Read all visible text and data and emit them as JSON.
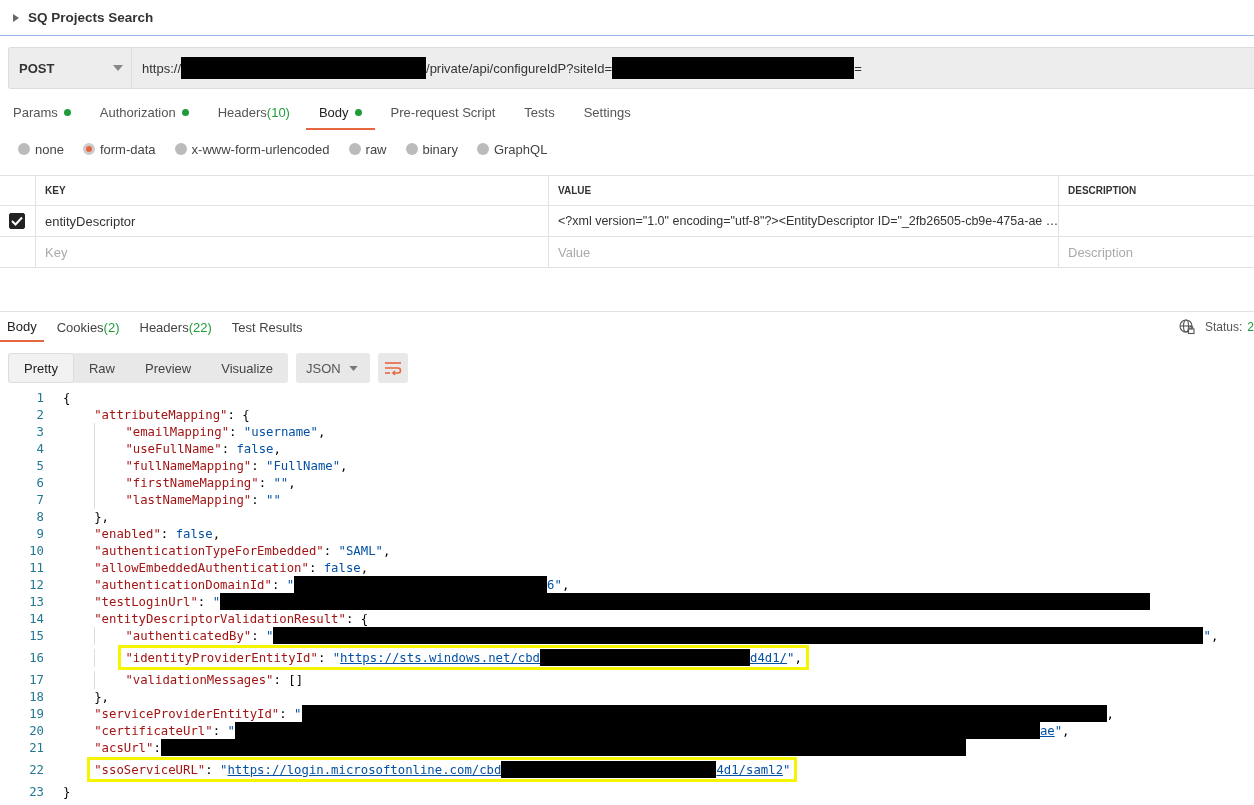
{
  "collection": {
    "title": "SQ Projects Search",
    "expanded": false
  },
  "request": {
    "method": "POST",
    "url": [
      {
        "kind": "text",
        "text": "https://"
      },
      {
        "kind": "redacted"
      },
      {
        "kind": "text",
        "text": "/private/api/configureIdP?siteId="
      },
      {
        "kind": "redacted"
      },
      {
        "kind": "text",
        "text": "="
      }
    ]
  },
  "request_tabs": [
    {
      "label": "Params",
      "dot": true,
      "selected": false
    },
    {
      "label": "Authorization",
      "dot": true,
      "selected": false
    },
    {
      "label": "Headers",
      "count": "(10)",
      "dot": false,
      "selected": false
    },
    {
      "label": "Body",
      "dot": true,
      "selected": true
    },
    {
      "label": "Pre-request Script",
      "dot": false,
      "selected": false
    },
    {
      "label": "Tests",
      "dot": false,
      "selected": false
    },
    {
      "label": "Settings",
      "dot": false,
      "selected": false
    }
  ],
  "body_types": [
    {
      "label": "none",
      "selected": false
    },
    {
      "label": "form-data",
      "selected": true
    },
    {
      "label": "x-www-form-urlencoded",
      "selected": false
    },
    {
      "label": "raw",
      "selected": false
    },
    {
      "label": "binary",
      "selected": false
    },
    {
      "label": "GraphQL",
      "selected": false
    }
  ],
  "form_table": {
    "columns": [
      "KEY",
      "VALUE",
      "DESCRIPTION"
    ],
    "rows": [
      {
        "checked": true,
        "key": "entityDescriptor",
        "value": "<?xml version=\"1.0\" encoding=\"utf-8\"?><EntityDescriptor ID=\"_2fb26505-cb9e-475a-ae …"
      }
    ],
    "empty_row": {
      "key": {
        "placeholder": "Key"
      },
      "value": {
        "placeholder": "Value"
      },
      "description": {
        "placeholder": "Description"
      }
    }
  },
  "response_tabs": [
    {
      "label": "Body",
      "selected": true
    },
    {
      "label": "Cookies",
      "count": "(2)",
      "selected": false
    },
    {
      "label": "Headers",
      "count": "(22)",
      "selected": false
    },
    {
      "label": "Test Results",
      "selected": false
    }
  ],
  "status": {
    "label": "Status:",
    "value": "2"
  },
  "view_modes": [
    {
      "label": "Pretty",
      "selected": true
    },
    {
      "label": "Raw",
      "selected": false
    },
    {
      "label": "Preview",
      "selected": false
    },
    {
      "label": "Visualize",
      "selected": false
    }
  ],
  "format": "JSON",
  "code": [
    {
      "number": "1",
      "segments": [
        {
          "kind": "punct",
          "text": "{"
        }
      ],
      "children": [
        {
          "number": "2",
          "segments": [
            {
              "kind": "key",
              "text": "\"attributeMapping\""
            },
            {
              "kind": "punct",
              "text": ": {"
            }
          ],
          "children": [
            {
              "number": "3",
              "segments": [
                {
                  "kind": "key",
                  "text": "\"emailMapping\""
                },
                {
                  "kind": "punct",
                  "text": ": "
                },
                {
                  "kind": "string",
                  "text": "\"username\""
                },
                {
                  "kind": "punct",
                  "text": ","
                }
              ]
            },
            {
              "number": "4",
              "segments": [
                {
                  "kind": "key",
                  "text": "\"useFullName\""
                },
                {
                  "kind": "punct",
                  "text": ": "
                },
                {
                  "kind": "string",
                  "text": "false"
                },
                {
                  "kind": "punct",
                  "text": ","
                }
              ]
            },
            {
              "number": "5",
              "segments": [
                {
                  "kind": "key",
                  "text": "\"fullNameMapping\""
                },
                {
                  "kind": "punct",
                  "text": ": "
                },
                {
                  "kind": "string",
                  "text": "\"FullName\""
                },
                {
                  "kind": "punct",
                  "text": ","
                }
              ]
            },
            {
              "number": "6",
              "segments": [
                {
                  "kind": "key",
                  "text": "\"firstNameMapping\""
                },
                {
                  "kind": "punct",
                  "text": ": "
                },
                {
                  "kind": "string",
                  "text": "\"\""
                },
                {
                  "kind": "punct",
                  "text": ","
                }
              ]
            },
            {
              "number": "7",
              "segments": [
                {
                  "kind": "key",
                  "text": "\"lastNameMapping\""
                },
                {
                  "kind": "punct",
                  "text": ": "
                },
                {
                  "kind": "string",
                  "text": "\"\""
                }
              ]
            }
          ]
        },
        {
          "number": "8",
          "segments": [
            {
              "kind": "punct",
              "text": "},"
            }
          ]
        },
        {
          "number": "9",
          "segments": [
            {
              "kind": "key",
              "text": "\"enabled\""
            },
            {
              "kind": "punct",
              "text": ": "
            },
            {
              "kind": "string",
              "text": "false"
            },
            {
              "kind": "punct",
              "text": ","
            }
          ]
        },
        {
          "number": "10",
          "segments": [
            {
              "kind": "key",
              "text": "\"authenticationTypeForEmbedded\""
            },
            {
              "kind": "punct",
              "text": ": "
            },
            {
              "kind": "string",
              "text": "\"SAML\""
            },
            {
              "kind": "punct",
              "text": ","
            }
          ]
        },
        {
          "number": "11",
          "segments": [
            {
              "kind": "key",
              "text": "\"allowEmbeddedAuthentication\""
            },
            {
              "kind": "punct",
              "text": ": "
            },
            {
              "kind": "string",
              "text": "false"
            },
            {
              "kind": "punct",
              "text": ","
            }
          ]
        },
        {
          "number": "12",
          "segments": [
            {
              "kind": "key",
              "text": "\"authenticationDomainId\""
            },
            {
              "kind": "punct",
              "text": ": "
            },
            {
              "kind": "string",
              "text": "\""
            },
            {
              "kind": "redacted"
            },
            {
              "kind": "string",
              "text": "6\""
            },
            {
              "kind": "punct",
              "text": ","
            }
          ]
        },
        {
          "number": "13",
          "segments": [
            {
              "kind": "key",
              "text": "\"testLoginUrl\""
            },
            {
              "kind": "punct",
              "text": ": "
            },
            {
              "kind": "string",
              "text": "\""
            },
            {
              "kind": "redacted"
            }
          ]
        },
        {
          "number": "14",
          "segments": [
            {
              "kind": "key",
              "text": "\"entityDescriptorValidationResult\""
            },
            {
              "kind": "punct",
              "text": ": {"
            }
          ],
          "children": [
            {
              "number": "15",
              "segments": [
                {
                  "kind": "key",
                  "text": "\"authenticatedBy\""
                },
                {
                  "kind": "punct",
                  "text": ": "
                },
                {
                  "kind": "string",
                  "text": "\""
                },
                {
                  "kind": "redacted"
                },
                {
                  "kind": "string",
                  "text": "\""
                },
                {
                  "kind": "punct",
                  "text": ","
                }
              ]
            },
            {
              "number": "16",
              "highlighted": true,
              "segments": [
                {
                  "kind": "key",
                  "text": "\"identityProviderEntityId\""
                },
                {
                  "kind": "punct",
                  "text": ": "
                },
                {
                  "kind": "string",
                  "text": "\""
                },
                {
                  "kind": "link",
                  "text": "https://sts.windows.net/cbd"
                },
                {
                  "kind": "redacted"
                },
                {
                  "kind": "link",
                  "text": "d4d1/"
                },
                {
                  "kind": "string",
                  "text": "\""
                },
                {
                  "kind": "punct",
                  "text": ","
                }
              ]
            },
            {
              "number": "17",
              "segments": [
                {
                  "kind": "key",
                  "text": "\"validationMessages\""
                },
                {
                  "kind": "punct",
                  "text": ": []"
                }
              ]
            }
          ]
        },
        {
          "number": "18",
          "segments": [
            {
              "kind": "punct",
              "text": "},"
            }
          ]
        },
        {
          "number": "19",
          "segments": [
            {
              "kind": "key",
              "text": "\"serviceProviderEntityId\""
            },
            {
              "kind": "punct",
              "text": ": "
            },
            {
              "kind": "string",
              "text": "\""
            },
            {
              "kind": "redacted"
            },
            {
              "kind": "punct",
              "text": ","
            }
          ]
        },
        {
          "number": "20",
          "segments": [
            {
              "kind": "key",
              "text": "\"certificateUrl\""
            },
            {
              "kind": "punct",
              "text": ": "
            },
            {
              "kind": "string",
              "text": "\""
            },
            {
              "kind": "redacted"
            },
            {
              "kind": "link",
              "text": "ae"
            },
            {
              "kind": "string",
              "text": "\""
            },
            {
              "kind": "punct",
              "text": ","
            }
          ]
        },
        {
          "number": "21",
          "segments": [
            {
              "kind": "key",
              "text": "\"acsUrl\""
            },
            {
              "kind": "punct",
              "text": ":"
            },
            {
              "kind": "redacted"
            }
          ]
        },
        {
          "number": "22",
          "highlighted": true,
          "segments": [
            {
              "kind": "key",
              "text": "\"ssoServiceURL\""
            },
            {
              "kind": "punct",
              "text": ": "
            },
            {
              "kind": "string",
              "text": "\""
            },
            {
              "kind": "link",
              "text": "https://login.microsoftonline.com/cbd"
            },
            {
              "kind": "redacted"
            },
            {
              "kind": "link",
              "text": "4d1/saml2"
            },
            {
              "kind": "string",
              "text": "\""
            }
          ]
        }
      ]
    },
    {
      "number": "23",
      "segments": [
        {
          "kind": "punct",
          "text": "}"
        }
      ]
    }
  ]
}
